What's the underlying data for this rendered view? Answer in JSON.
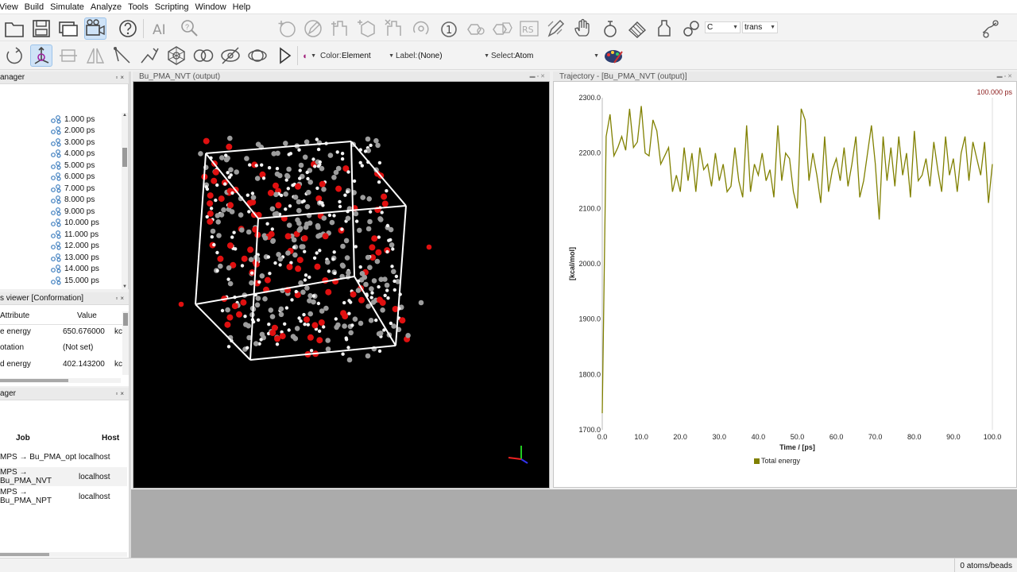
{
  "menu": [
    "View",
    "Build",
    "Simulate",
    "Analyze",
    "Tools",
    "Scripting",
    "Window",
    "Help"
  ],
  "toolbar": {
    "element_combo": "C",
    "conformation_combo": "trans",
    "color_label": "Color:",
    "color_value": "Element",
    "label_label": "Label:",
    "label_value": "(None)",
    "select_label": "Select:",
    "select_value": "Atom"
  },
  "tree_panel": {
    "title": "anager",
    "items": [
      "1.000 ps",
      "2.000 ps",
      "3.000 ps",
      "4.000 ps",
      "5.000 ps",
      "6.000 ps",
      "7.000 ps",
      "8.000 ps",
      "9.000 ps",
      "10.000 ps",
      "11.000 ps",
      "12.000 ps",
      "13.000 ps",
      "14.000 ps",
      "15.000 ps"
    ]
  },
  "props_panel": {
    "title": "s viewer [Conformation]",
    "col_attr": "Attribute",
    "col_value": "Value",
    "rows": [
      {
        "attr": "e energy",
        "value": "650.676000",
        "unit": "kc"
      },
      {
        "attr": "otation",
        "value": "(Not set)",
        "unit": ""
      },
      {
        "attr": "d energy",
        "value": "402.143200",
        "unit": "kc"
      }
    ]
  },
  "jobs_panel": {
    "title": "ager",
    "col_job": "Job",
    "col_host": "Host",
    "rows": [
      {
        "job": "MPS → Bu_PMA_opt",
        "host": "localhost"
      },
      {
        "job": "MPS → Bu_PMA_NVT",
        "host": "localhost"
      },
      {
        "job": "MPS → Bu_PMA_NPT",
        "host": "localhost"
      }
    ]
  },
  "viewer": {
    "title": "Bu_PMA_NVT (output)"
  },
  "chart_window": {
    "title": "Trajectory - [Bu_PMA_NVT (output)]",
    "time_marker": "100.000 ps"
  },
  "chart_data": {
    "type": "line",
    "xlabel": "Time / [ps]",
    "ylabel": "[kcal/mol]",
    "xlim": [
      0,
      100
    ],
    "ylim": [
      1700,
      2300
    ],
    "xticks": [
      "0.0",
      "10.0",
      "20.0",
      "30.0",
      "40.0",
      "50.0",
      "60.0",
      "70.0",
      "80.0",
      "90.0",
      "100.0"
    ],
    "yticks": [
      "1700.0",
      "1800.0",
      "1900.0",
      "2000.0",
      "2100.0",
      "2200.0",
      "2300.0"
    ],
    "legend": "bottom",
    "series": [
      {
        "name": "Total energy",
        "color": "#808000",
        "x": [
          0,
          1,
          2,
          3,
          4,
          5,
          6,
          7,
          8,
          9,
          10,
          11,
          12,
          13,
          14,
          15,
          16,
          17,
          18,
          19,
          20,
          21,
          22,
          23,
          24,
          25,
          26,
          27,
          28,
          29,
          30,
          31,
          32,
          33,
          34,
          35,
          36,
          37,
          38,
          39,
          40,
          41,
          42,
          43,
          44,
          45,
          46,
          47,
          48,
          49,
          50,
          51,
          52,
          53,
          54,
          55,
          56,
          57,
          58,
          59,
          60,
          61,
          62,
          63,
          64,
          65,
          66,
          67,
          68,
          69,
          70,
          71,
          72,
          73,
          74,
          75,
          76,
          77,
          78,
          79,
          80,
          81,
          82,
          83,
          84,
          85,
          86,
          87,
          88,
          89,
          90,
          91,
          92,
          93,
          94,
          95,
          96,
          97,
          98,
          99,
          100
        ],
        "y": [
          1730,
          2230,
          2270,
          2195,
          2210,
          2230,
          2205,
          2280,
          2210,
          2220,
          2285,
          2200,
          2195,
          2260,
          2240,
          2180,
          2195,
          2210,
          2130,
          2160,
          2130,
          2210,
          2150,
          2200,
          2130,
          2210,
          2170,
          2180,
          2140,
          2200,
          2150,
          2180,
          2130,
          2140,
          2210,
          2150,
          2120,
          2250,
          2130,
          2180,
          2160,
          2200,
          2150,
          2170,
          2120,
          2250,
          2150,
          2200,
          2190,
          2130,
          2100,
          2280,
          2260,
          2150,
          2200,
          2160,
          2110,
          2230,
          2130,
          2170,
          2190,
          2150,
          2210,
          2140,
          2180,
          2230,
          2120,
          2150,
          2200,
          2250,
          2180,
          2080,
          2230,
          2150,
          2210,
          2140,
          2230,
          2160,
          2200,
          2120,
          2240,
          2150,
          2160,
          2190,
          2140,
          2220,
          2170,
          2130,
          2230,
          2160,
          2190,
          2130,
          2200,
          2230,
          2150,
          2220,
          2190,
          2160,
          2220,
          2110,
          2180
        ]
      }
    ]
  },
  "status": {
    "text": "0 atoms/beads"
  }
}
